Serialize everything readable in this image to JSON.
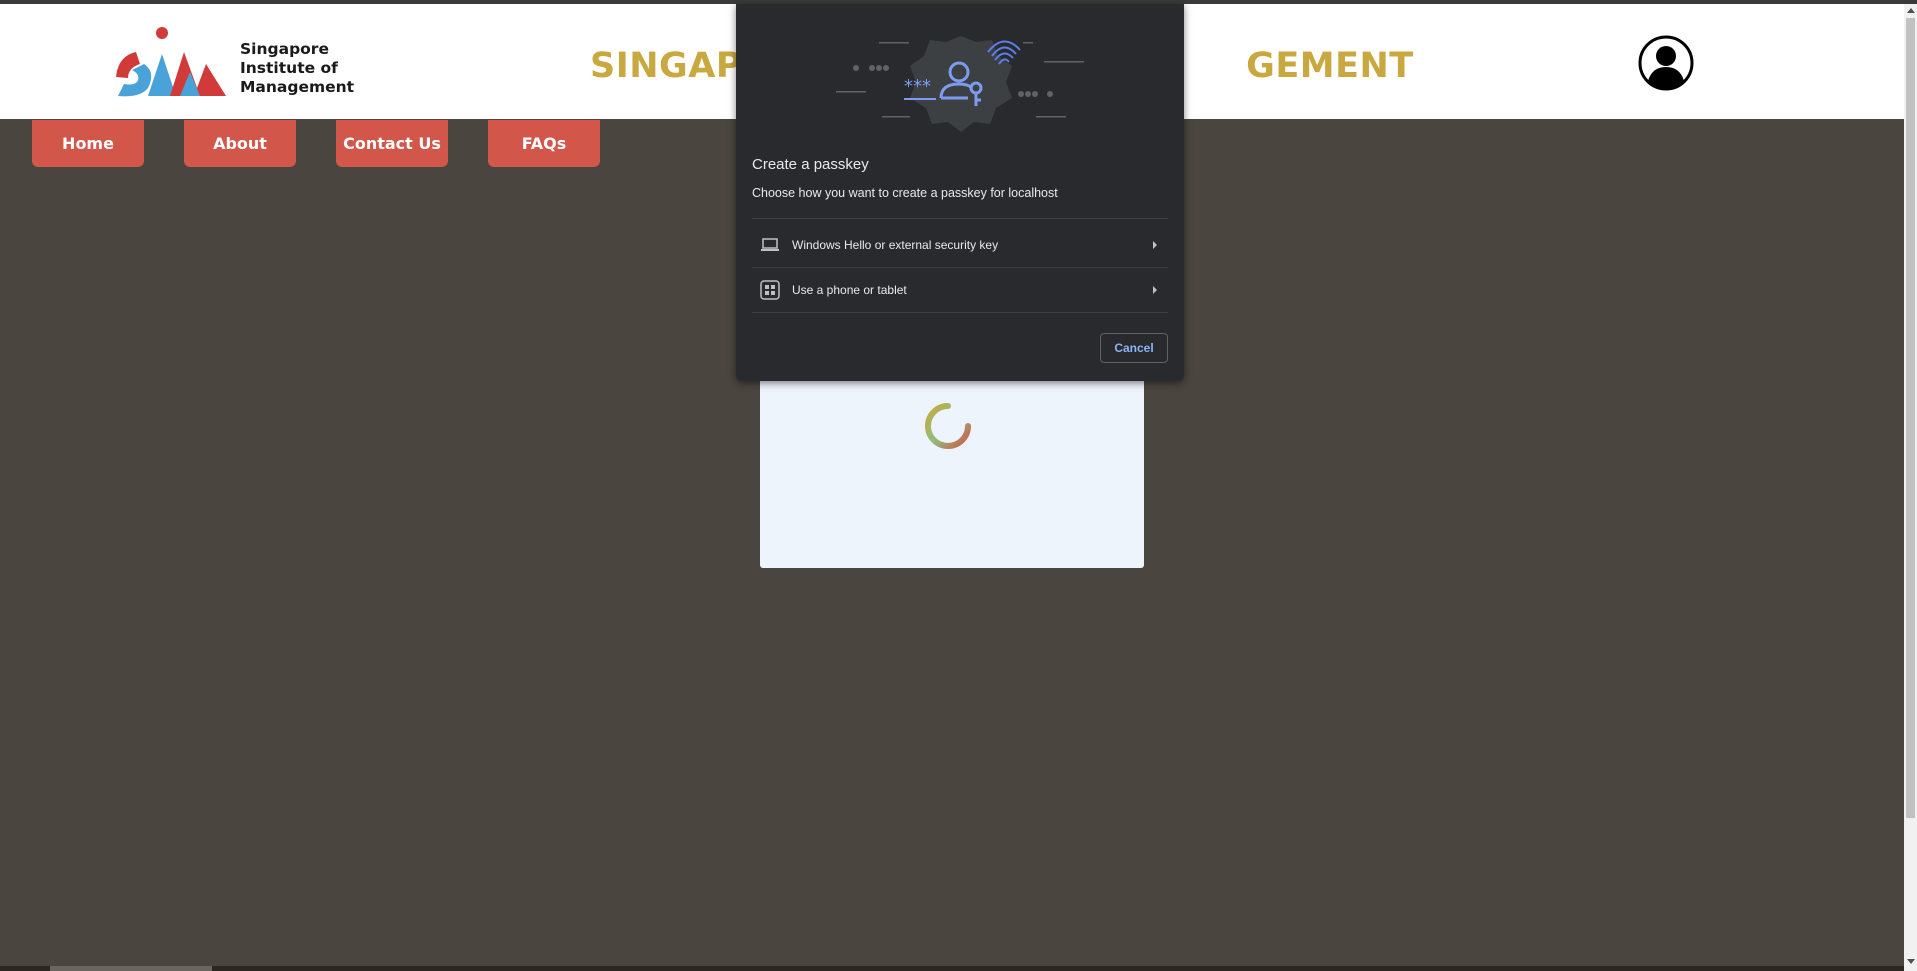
{
  "header": {
    "logo_lines": [
      "Singapore",
      "Institute of",
      "Management"
    ],
    "title_left": "SINGAPO",
    "title_right": "GEMENT"
  },
  "nav": {
    "home": "Home",
    "about": "About",
    "contact": "Contact Us",
    "faqs": "FAQs"
  },
  "dialog": {
    "title": "Create a passkey",
    "subtitle": "Choose how you want to create a passkey for localhost",
    "options": [
      {
        "label": "Windows Hello or external security key",
        "icon": "laptop-icon"
      },
      {
        "label": "Use a phone or tablet",
        "icon": "qr-code-icon"
      }
    ],
    "cancel": "Cancel"
  },
  "colors": {
    "background": "#4a453e",
    "nav_button": "#d2564a",
    "title_gold": "#c9a83f",
    "dialog_bg": "#292a2d",
    "dialog_accent": "#8ab4f8"
  }
}
